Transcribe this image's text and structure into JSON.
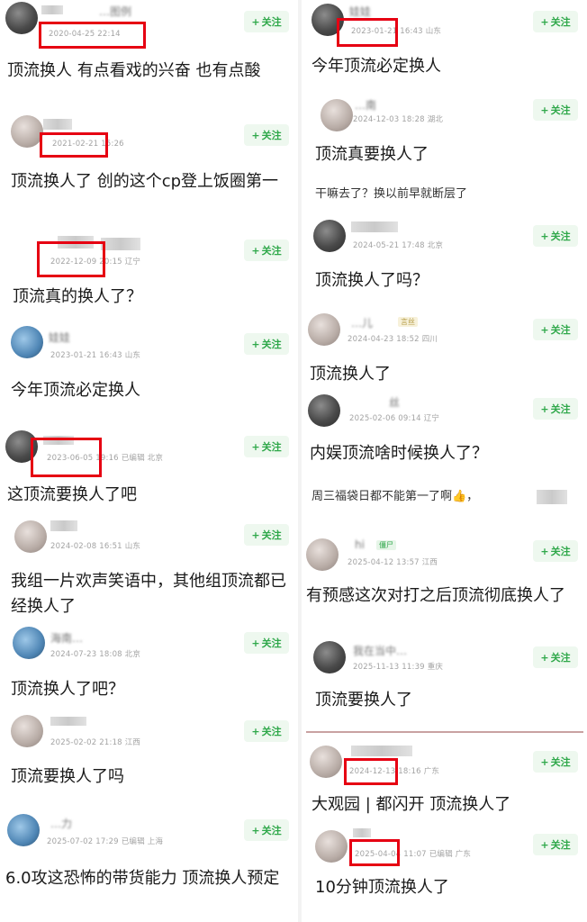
{
  "follow_label": "关注",
  "colors": {
    "highlight": "#e60012",
    "follow_text": "#2fa84a",
    "follow_bg": "#eef8ef"
  },
  "left": [
    {
      "time": "2020-04-25 22:14",
      "location": "",
      "edited": "",
      "text": "顶流换人 有点看戏的兴奋 也有点酸",
      "username": "…图例"
    },
    {
      "time": "2021-02-21 15:26",
      "location": "",
      "edited": "",
      "text": "顶流换人了 创的这个cp登上饭圈第一",
      "username": ""
    },
    {
      "time": "2022-12-09 20:15",
      "location": "辽宁",
      "edited": "",
      "text": "顶流真的换人了？",
      "username": "鼠鼠…"
    },
    {
      "time": "2023-01-21 16:43",
      "location": "山东",
      "edited": "",
      "text": "今年顶流必定换人",
      "username": "娃娃"
    },
    {
      "time": "2023-06-05 19:16",
      "location": "北京",
      "edited": "已编辑",
      "text": "这顶流要换人了吧",
      "username": ""
    },
    {
      "time": "2024-02-08 16:51",
      "location": "山东",
      "edited": "",
      "text": "我组一片欢声笑语中，其他组顶流都已经换人了",
      "username": ""
    },
    {
      "time": "2024-07-23 18:08",
      "location": "北京",
      "edited": "",
      "text": "顶流换人了吧？",
      "username": "海南…"
    },
    {
      "time": "2025-02-02 21:18",
      "location": "江西",
      "edited": "",
      "text": "顶流要换人了吗",
      "username": ""
    },
    {
      "time": "2025-07-02 17:29",
      "location": "上海",
      "edited": "已编辑",
      "text": "6.0攻这恐怖的带货能力 顶流换人预定",
      "username": "…力"
    }
  ],
  "right": [
    {
      "time": "2023-01-21 16:43",
      "location": "山东",
      "edited": "",
      "text": "今年顶流必定换人",
      "username": "娃娃"
    },
    {
      "time": "2024-12-03 18:28",
      "location": "湖北",
      "edited": "",
      "text": "顶流真要换人了",
      "username": "…南"
    },
    {
      "time": "",
      "location": "",
      "edited": "",
      "text": "干嘛去了？换以前早就断层了",
      "username": ""
    },
    {
      "time": "2024-05-21 17:48",
      "location": "北京",
      "edited": "",
      "text": "顶流换人了吗？",
      "username": ""
    },
    {
      "time": "2024-04-23 18:52",
      "location": "四川",
      "edited": "",
      "text": "顶流换人了",
      "username": "…儿",
      "badge": "言丝"
    },
    {
      "time": "2025-02-06 09:14",
      "location": "辽宁",
      "edited": "",
      "text": "内娱顶流啥时候换人了？",
      "username": "丝"
    },
    {
      "time": "",
      "location": "",
      "edited": "",
      "text": "周三福袋日都不能第一了啊👍，",
      "username": ""
    },
    {
      "time": "2025-04-12 13:57",
      "location": "江西",
      "edited": "",
      "text": "有预感这次对打之后顶流彻底换人了",
      "username": "hi",
      "badge": "僵尸"
    },
    {
      "time": "2025-11-13 11:39",
      "location": "重庆",
      "edited": "",
      "text": "顶流要换人了",
      "username": "我在当中…"
    },
    {
      "time": "2024-12-13 18:16",
      "location": "广东",
      "edited": "",
      "text": "大观园 | 都闪开 顶流换人了",
      "username": ""
    },
    {
      "time": "2025-04-04 11:07",
      "location": "广东",
      "edited": "已编辑",
      "text": "10分钟顶流换人了",
      "username": ""
    }
  ]
}
